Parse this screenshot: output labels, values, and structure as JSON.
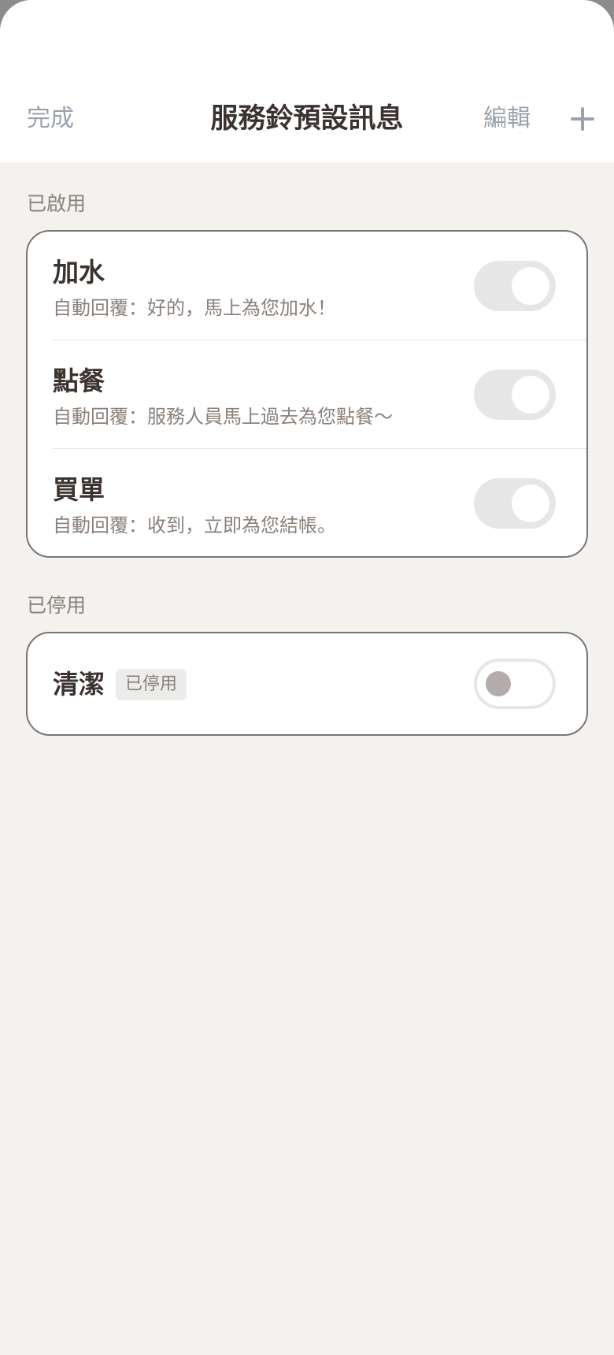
{
  "header": {
    "done_label": "完成",
    "title": "服務鈴預設訊息",
    "edit_label": "編輯",
    "add_icon": "plus-icon"
  },
  "enabled_section": {
    "title": "已啟用",
    "items": [
      {
        "title": "加水",
        "reply": "自動回覆：好的，馬上為您加水！",
        "enabled": true
      },
      {
        "title": "點餐",
        "reply": "自動回覆：服務人員馬上過去為您點餐～",
        "enabled": true
      },
      {
        "title": "買單",
        "reply": "自動回覆：收到，立即為您結帳。",
        "enabled": true
      }
    ]
  },
  "disabled_section": {
    "title": "已停用",
    "items": [
      {
        "title": "清潔",
        "badge": "已停用",
        "enabled": false
      }
    ]
  },
  "colors": {
    "background": "#f3f2ef",
    "title_text": "#3b3330",
    "secondary_text": "#8a817b",
    "header_action": "#9aa3ad"
  }
}
